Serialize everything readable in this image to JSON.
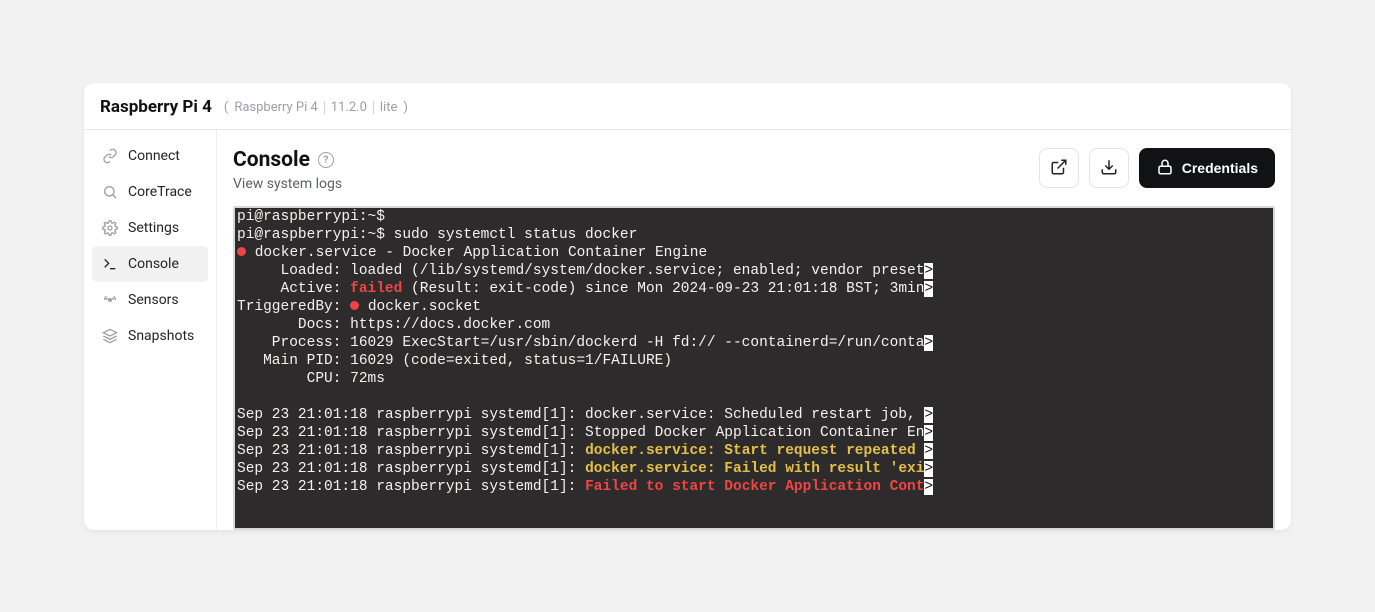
{
  "header": {
    "title": "Raspberry Pi 4",
    "model": "Raspberry Pi 4",
    "version": "11.2.0",
    "variant": "lite"
  },
  "sidebar": {
    "items": [
      {
        "label": "Connect",
        "active": false
      },
      {
        "label": "CoreTrace",
        "active": false
      },
      {
        "label": "Settings",
        "active": false
      },
      {
        "label": "Console",
        "active": true
      },
      {
        "label": "Sensors",
        "active": false
      },
      {
        "label": "Snapshots",
        "active": false
      }
    ]
  },
  "main": {
    "title": "Console",
    "subtitle": "View system logs",
    "credentials_label": "Credentials"
  },
  "console": {
    "prompt_empty": "pi@raspberrypi:~$",
    "prompt_cmd": "pi@raspberrypi:~$ sudo systemctl status docker",
    "service_line_prefix": " ",
    "service_line": "docker.service - Docker Application Container Engine",
    "loaded": "     Loaded: loaded (/lib/systemd/system/docker.service; enabled; vendor preset",
    "active_label": "     Active: ",
    "active_value": "failed",
    "active_rest": " (Result: exit-code) since Mon 2024-09-23 21:01:18 BST; 3min",
    "triggered_label": "TriggeredBy: ",
    "triggered_value": " docker.socket",
    "docs": "       Docs: https://docs.docker.com",
    "process": "    Process: 16029 ExecStart=/usr/sbin/dockerd -H fd:// --containerd=/run/conta",
    "mainpid": "   Main PID: 16029 (code=exited, status=1/FAILURE)",
    "cpu": "        CPU: 72ms",
    "log1_pre": "Sep 23 21:01:18 raspberrypi systemd[1]: docker.service: Scheduled restart job, ",
    "log2_pre": "Sep 23 21:01:18 raspberrypi systemd[1]: Stopped Docker Application Container En",
    "log3_pre": "Sep 23 21:01:18 raspberrypi systemd[1]: ",
    "log3_hi": "docker.service: Start request repeated ",
    "log4_pre": "Sep 23 21:01:18 raspberrypi systemd[1]: ",
    "log4_hi": "docker.service: Failed with result 'exi",
    "log5_pre": "Sep 23 21:01:18 raspberrypi systemd[1]: ",
    "log5_hi": "Failed to start Docker Application Cont",
    "overflow": ">"
  }
}
